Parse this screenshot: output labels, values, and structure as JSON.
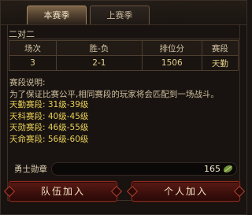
{
  "tabs": [
    {
      "label": "本赛季",
      "active": true
    },
    {
      "label": "上赛季",
      "active": false
    }
  ],
  "mode_title": "二对二",
  "table": {
    "headers": [
      "场次",
      "胜-负",
      "排位分",
      "赛段"
    ],
    "row": [
      "3",
      "2-1",
      "1506",
      "天勤"
    ]
  },
  "description": {
    "title": "赛段说明:",
    "text": "为了保证比赛公平,相同赛段的玩家将会匹配到一场战斗。",
    "tiers": [
      "天勤赛段: 31级-39级",
      "天科赛段: 40级-45级",
      "天勋赛段: 46级-55级",
      "天命赛段: 56级-60级"
    ]
  },
  "medal": {
    "label": "勇士勋章",
    "value": "165",
    "icon": "leaf-icon"
  },
  "buttons": {
    "team_join": "队伍加入",
    "solo_join": "个人加入"
  },
  "colors": {
    "gold_text": "#e8cf57",
    "button_red": "#5a1a14",
    "panel_bg": "#181310"
  }
}
